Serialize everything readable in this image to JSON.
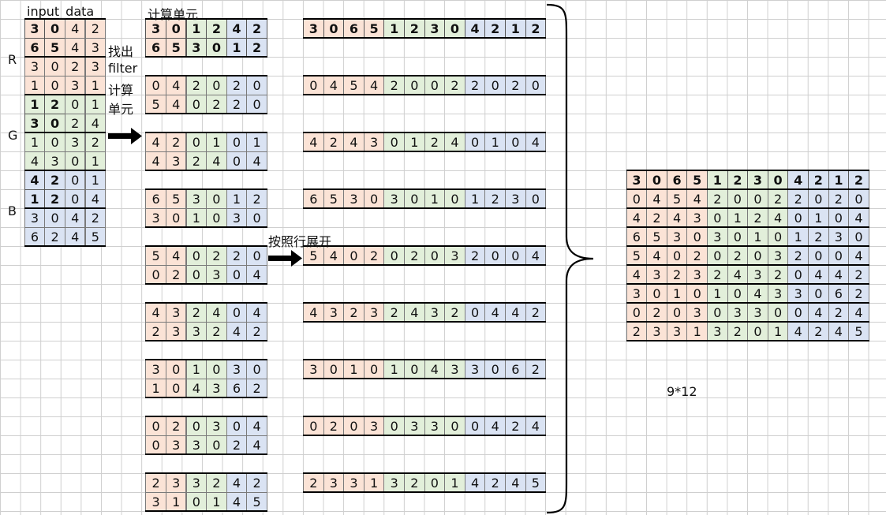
{
  "labels": {
    "input_title": "input_data",
    "find_filter_1": "找出",
    "find_filter_2": "filter",
    "calc_unit_1": "计算",
    "calc_unit_2": "单元",
    "calc_unit_title": "计算单元",
    "expand_by_row": "按照行展开",
    "channel_r": "R",
    "channel_g": "G",
    "channel_b": "B",
    "result_size": "9*12"
  },
  "colors": {
    "r": "#fbe3d6",
    "g": "#e2efda",
    "b": "#dae3f3",
    "grid": "#cfcfcf"
  },
  "input_data": {
    "R": [
      [
        "3",
        "0",
        "4",
        "2"
      ],
      [
        "6",
        "5",
        "4",
        "3"
      ],
      [
        "3",
        "0",
        "2",
        "3"
      ],
      [
        "1",
        "0",
        "3",
        "1"
      ]
    ],
    "G": [
      [
        "1",
        "2",
        "0",
        "1"
      ],
      [
        "3",
        "0",
        "2",
        "4"
      ],
      [
        "1",
        "0",
        "3",
        "2"
      ],
      [
        "4",
        "3",
        "0",
        "1"
      ]
    ],
    "B": [
      [
        "4",
        "2",
        "0",
        "1"
      ],
      [
        "1",
        "2",
        "0",
        "4"
      ],
      [
        "3",
        "0",
        "4",
        "2"
      ],
      [
        "6",
        "2",
        "4",
        "5"
      ]
    ]
  },
  "calc_units": [
    [
      [
        "3",
        "0",
        "1",
        "2",
        "4",
        "2"
      ],
      [
        "6",
        "5",
        "3",
        "0",
        "1",
        "2"
      ]
    ],
    [
      [
        "0",
        "4",
        "2",
        "0",
        "2",
        "0"
      ],
      [
        "5",
        "4",
        "0",
        "2",
        "2",
        "0"
      ]
    ],
    [
      [
        "4",
        "2",
        "0",
        "1",
        "0",
        "1"
      ],
      [
        "4",
        "3",
        "2",
        "4",
        "0",
        "4"
      ]
    ],
    [
      [
        "6",
        "5",
        "3",
        "0",
        "1",
        "2"
      ],
      [
        "3",
        "0",
        "1",
        "0",
        "3",
        "0"
      ]
    ],
    [
      [
        "5",
        "4",
        "0",
        "2",
        "2",
        "0"
      ],
      [
        "0",
        "2",
        "0",
        "3",
        "0",
        "4"
      ]
    ],
    [
      [
        "4",
        "3",
        "2",
        "4",
        "0",
        "4"
      ],
      [
        "2",
        "3",
        "3",
        "2",
        "4",
        "2"
      ]
    ],
    [
      [
        "3",
        "0",
        "1",
        "0",
        "3",
        "0"
      ],
      [
        "1",
        "0",
        "4",
        "3",
        "6",
        "2"
      ]
    ],
    [
      [
        "0",
        "2",
        "0",
        "3",
        "0",
        "4"
      ],
      [
        "0",
        "3",
        "3",
        "0",
        "2",
        "4"
      ]
    ],
    [
      [
        "2",
        "3",
        "3",
        "2",
        "4",
        "2"
      ],
      [
        "3",
        "1",
        "0",
        "1",
        "4",
        "5"
      ]
    ]
  ],
  "expanded_rows": [
    [
      "3",
      "0",
      "6",
      "5",
      "1",
      "2",
      "3",
      "0",
      "4",
      "2",
      "1",
      "2"
    ],
    [
      "0",
      "4",
      "5",
      "4",
      "2",
      "0",
      "0",
      "2",
      "2",
      "0",
      "2",
      "0"
    ],
    [
      "4",
      "2",
      "4",
      "3",
      "0",
      "1",
      "2",
      "4",
      "0",
      "1",
      "0",
      "4"
    ],
    [
      "6",
      "5",
      "3",
      "0",
      "3",
      "0",
      "1",
      "0",
      "1",
      "2",
      "3",
      "0"
    ],
    [
      "5",
      "4",
      "0",
      "2",
      "0",
      "2",
      "0",
      "3",
      "2",
      "0",
      "0",
      "4"
    ],
    [
      "4",
      "3",
      "2",
      "3",
      "2",
      "4",
      "3",
      "2",
      "0",
      "4",
      "4",
      "2"
    ],
    [
      "3",
      "0",
      "1",
      "0",
      "1",
      "0",
      "4",
      "3",
      "3",
      "0",
      "6",
      "2"
    ],
    [
      "0",
      "2",
      "0",
      "3",
      "0",
      "3",
      "3",
      "0",
      "0",
      "4",
      "2",
      "4"
    ],
    [
      "2",
      "3",
      "3",
      "1",
      "3",
      "2",
      "0",
      "1",
      "4",
      "2",
      "4",
      "5"
    ]
  ]
}
